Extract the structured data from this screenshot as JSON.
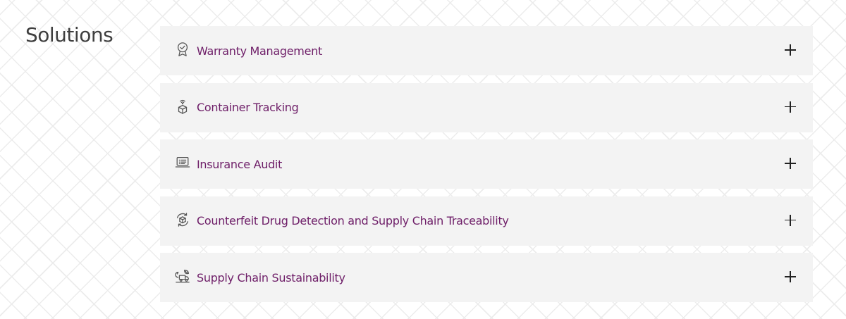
{
  "section": {
    "title": "Solutions"
  },
  "accordion": {
    "items": [
      {
        "label": "Warranty Management",
        "icon": "award-badge-icon"
      },
      {
        "label": "Container Tracking",
        "icon": "container-tracking-icon"
      },
      {
        "label": "Insurance Audit",
        "icon": "laptop-document-icon"
      },
      {
        "label": "Counterfeit Drug Detection and Supply Chain Traceability",
        "icon": "cycle-box-icon"
      },
      {
        "label": "Supply Chain Sustainability",
        "icon": "eco-supply-chain-icon"
      }
    ]
  },
  "colors": {
    "label": "#6e1e68",
    "panel": "#f3f3f3",
    "title": "#3f3f3f",
    "icon": "#555555"
  }
}
